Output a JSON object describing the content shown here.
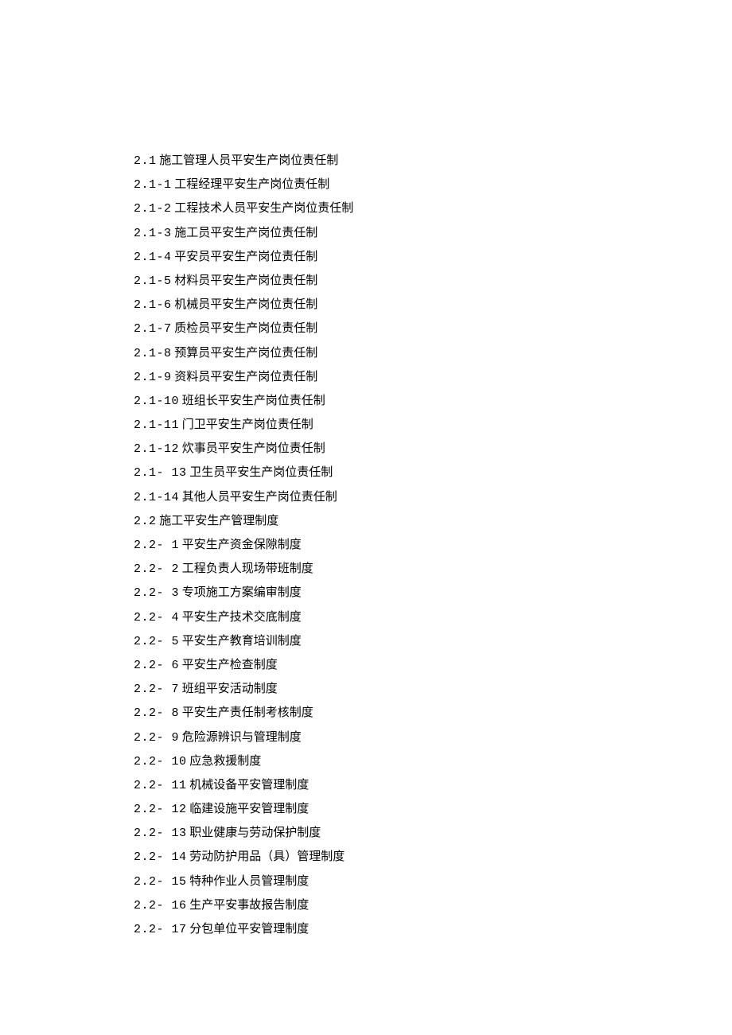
{
  "toc": {
    "items": [
      {
        "number": "2.1",
        "text": "施工管理人员平安生产岗位责任制"
      },
      {
        "number": "2.1-1",
        "text": "工程经理平安生产岗位责任制"
      },
      {
        "number": "2.1-2",
        "text": "工程技术人员平安生产岗位责任制"
      },
      {
        "number": "2.1-3",
        "text": "施工员平安生产岗位责任制"
      },
      {
        "number": "2.1-4",
        "text": "平安员平安生产岗位责任制"
      },
      {
        "number": "2.1-5",
        "text": "材料员平安生产岗位责任制"
      },
      {
        "number": "2.1-6",
        "text": "机械员平安生产岗位责任制"
      },
      {
        "number": "2.1-7",
        "text": "质检员平安生产岗位责任制"
      },
      {
        "number": "2.1-8",
        "text": "预算员平安生产岗位责任制"
      },
      {
        "number": "2.1-9",
        "text": "资料员平安生产岗位责任制"
      },
      {
        "number": "2.1-10",
        "text": "班组长平安生产岗位责任制"
      },
      {
        "number": "2.1-11",
        "text": "门卫平安生产岗位责任制"
      },
      {
        "number": "2.1-12",
        "text": "炊事员平安生产岗位责任制"
      },
      {
        "number": "2.1-  13",
        "text": "卫生员平安生产岗位责任制"
      },
      {
        "number": "2.1-14",
        "text": "其他人员平安生产岗位责任制"
      },
      {
        "number": "2.2",
        "text": "施工平安生产管理制度"
      },
      {
        "number": "2.2-  1",
        "text": "平安生产资金保隙制度"
      },
      {
        "number": "2.2-  2",
        "text": "工程负责人现场带班制度"
      },
      {
        "number": "2.2-  3",
        "text": "专项施工方案编审制度"
      },
      {
        "number": "2.2-  4",
        "text": "平安生产技术交底制度"
      },
      {
        "number": "2.2-  5",
        "text": "平安生产教育培训制度"
      },
      {
        "number": "2.2-  6",
        "text": "平安生产检查制度"
      },
      {
        "number": "2.2-  7",
        "text": "班组平安活动制度"
      },
      {
        "number": "2.2-  8",
        "text": "平安生产责任制考核制度"
      },
      {
        "number": "2.2-  9",
        "text": "危险源辨识与管理制度"
      },
      {
        "number": "2.2-  10",
        "text": "应急救援制度"
      },
      {
        "number": "2.2-  11",
        "text": "机械设备平安管理制度"
      },
      {
        "number": "2.2-  12",
        "text": "临建设施平安管理制度"
      },
      {
        "number": "2.2-  13",
        "text": "职业健康与劳动保护制度"
      },
      {
        "number": "2.2-  14",
        "text": "劳动防护用品（具）管理制度"
      },
      {
        "number": "2.2-  15",
        "text": "特种作业人员管理制度"
      },
      {
        "number": "2.2-  16",
        "text": "生产平安事故报告制度"
      },
      {
        "number": "2.2-  17",
        "text": "分包单位平安管理制度"
      }
    ]
  }
}
